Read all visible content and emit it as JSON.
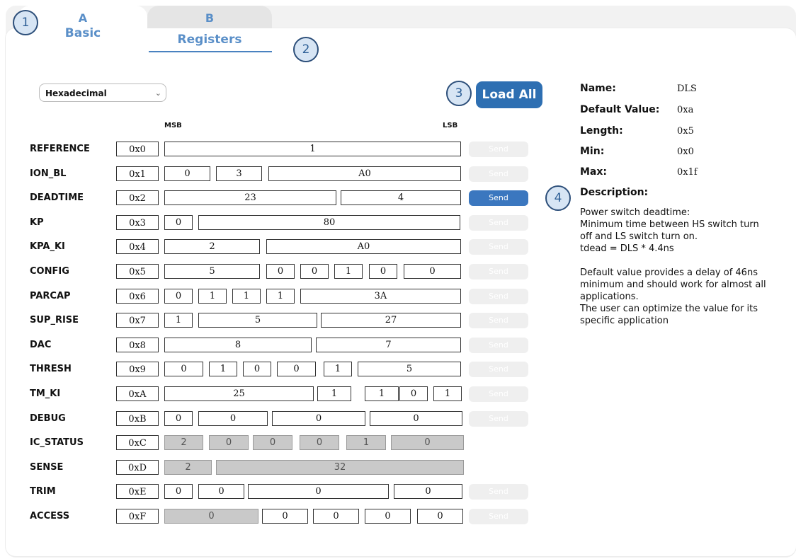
{
  "tabs": {
    "a": {
      "letter": "A",
      "label": "Basic"
    },
    "b": {
      "letter": "B",
      "label": "Registers"
    }
  },
  "callouts": [
    "1",
    "2",
    "3",
    "4"
  ],
  "format_select": {
    "value": "Hexadecimal"
  },
  "load_all_label": "Load All",
  "msb_label": "MSB",
  "lsb_label": "LSB",
  "send_label": "Send",
  "registers": [
    {
      "name": "REFERENCE",
      "addr": "0x0",
      "fields": [
        {
          "v": "1"
        }
      ],
      "send": "disabled"
    },
    {
      "name": "ION_BL",
      "addr": "0x1",
      "fields": [
        {
          "v": "0"
        },
        {
          "v": "3"
        },
        {
          "v": "A0"
        }
      ],
      "send": "disabled"
    },
    {
      "name": "DEADTIME",
      "addr": "0x2",
      "fields": [
        {
          "v": "23"
        },
        {
          "v": "4"
        }
      ],
      "send": "active"
    },
    {
      "name": "KP",
      "addr": "0x3",
      "fields": [
        {
          "v": "0"
        },
        {
          "v": "80"
        }
      ],
      "send": "disabled"
    },
    {
      "name": "KPA_KI",
      "addr": "0x4",
      "fields": [
        {
          "v": "2"
        },
        {
          "v": "A0"
        }
      ],
      "send": "disabled"
    },
    {
      "name": "CONFIG",
      "addr": "0x5",
      "fields": [
        {
          "v": "5"
        },
        {
          "v": "0"
        },
        {
          "v": "0"
        },
        {
          "v": "1"
        },
        {
          "v": "0"
        },
        {
          "v": "0"
        }
      ],
      "send": "disabled"
    },
    {
      "name": "PARCAP",
      "addr": "0x6",
      "fields": [
        {
          "v": "0"
        },
        {
          "v": "1"
        },
        {
          "v": "1"
        },
        {
          "v": "1"
        },
        {
          "v": "3A"
        }
      ],
      "send": "disabled"
    },
    {
      "name": "SUP_RISE",
      "addr": "0x7",
      "fields": [
        {
          "v": "1"
        },
        {
          "v": "5"
        },
        {
          "v": "27"
        }
      ],
      "send": "disabled"
    },
    {
      "name": "DAC",
      "addr": "0x8",
      "fields": [
        {
          "v": "8"
        },
        {
          "v": "7"
        }
      ],
      "send": "disabled"
    },
    {
      "name": "THRESH",
      "addr": "0x9",
      "fields": [
        {
          "v": "0"
        },
        {
          "v": "1"
        },
        {
          "v": "0"
        },
        {
          "v": "0"
        },
        {
          "v": "1"
        },
        {
          "v": "5"
        }
      ],
      "send": "disabled"
    },
    {
      "name": "TM_KI",
      "addr": "0xA",
      "fields": [
        {
          "v": "25"
        },
        {
          "v": "1"
        },
        {
          "v": "1"
        },
        {
          "v": "0"
        },
        {
          "v": "1"
        }
      ],
      "send": "disabled"
    },
    {
      "name": "DEBUG",
      "addr": "0xB",
      "fields": [
        {
          "v": "0"
        },
        {
          "v": "0"
        },
        {
          "v": "0"
        },
        {
          "v": "0"
        }
      ],
      "send": "disabled"
    },
    {
      "name": "IC_STATUS",
      "addr": "0xC",
      "fields": [
        {
          "v": "2",
          "ro": true
        },
        {
          "v": "0",
          "ro": true
        },
        {
          "v": "0",
          "ro": true
        },
        {
          "v": "0",
          "ro": true
        },
        {
          "v": "1",
          "ro": true
        },
        {
          "v": "0",
          "ro": true
        }
      ],
      "send": "none"
    },
    {
      "name": "SENSE",
      "addr": "0xD",
      "fields": [
        {
          "v": "2",
          "ro": true
        },
        {
          "v": "32",
          "ro": true
        }
      ],
      "send": "none"
    },
    {
      "name": "TRIM",
      "addr": "0xE",
      "fields": [
        {
          "v": "0"
        },
        {
          "v": "0"
        },
        {
          "v": "0"
        },
        {
          "v": "0"
        }
      ],
      "send": "disabled"
    },
    {
      "name": "ACCESS",
      "addr": "0xF",
      "fields": [
        {
          "v": "0",
          "ro": true
        },
        {
          "v": "0"
        },
        {
          "v": "0"
        },
        {
          "v": "0"
        },
        {
          "v": "0"
        }
      ],
      "send": "disabled"
    }
  ],
  "info": {
    "name_label": "Name:",
    "name_value": "DLS",
    "default_label": "Default Value:",
    "default_value": "0xa",
    "length_label": "Length:",
    "length_value": "0x5",
    "min_label": "Min:",
    "min_value": "0x0",
    "max_label": "Max:",
    "max_value": "0x1f",
    "description_label": "Description:",
    "description_lines": [
      "Power switch deadtime:",
      "Minimum time between HS switch turn off and LS switch turn on.",
      "tdead = DLS * 4.4ns",
      "",
      "Default value provides a delay of 46ns minimum and should work for almost all applications.",
      "The user can optimize the value for its specific application"
    ]
  },
  "colors": {
    "accent": "#2e6fb2",
    "tab_text": "#5a8fc8",
    "readonly_field": "#c9c9c9"
  }
}
